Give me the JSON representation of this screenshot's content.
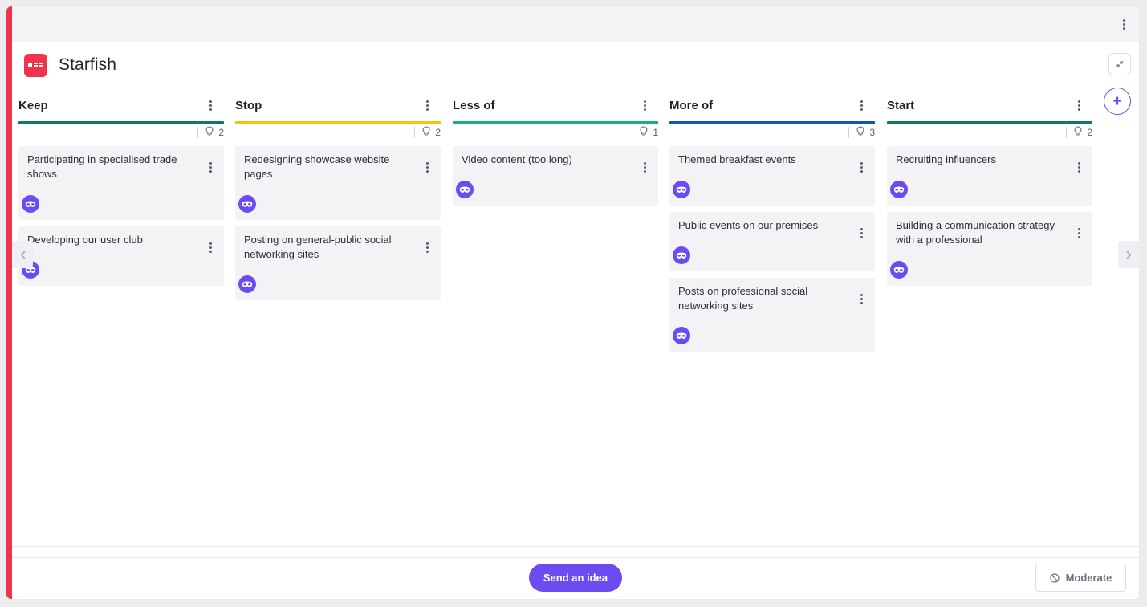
{
  "board": {
    "title": "Starfish",
    "colors": {
      "accent": "#f0344f",
      "primary": "#6b4cf0"
    }
  },
  "toolbar": {
    "menu_icon": "kebab-vertical-icon",
    "collapse_icon": "collapse-arrows-icon",
    "add_column_label": "+"
  },
  "columns": [
    {
      "title": "Keep",
      "color": "#0f7a64",
      "count": "2",
      "cards": [
        {
          "text": "Participating in specialised trade shows"
        },
        {
          "text": "Developing our user club"
        }
      ]
    },
    {
      "title": "Stop",
      "color": "#f4c316",
      "count": "2",
      "cards": [
        {
          "text": "Redesigning showcase website pages"
        },
        {
          "text": "Posting on general-public social networking sites"
        }
      ]
    },
    {
      "title": "Less of",
      "color": "#17b27c",
      "count": "1",
      "cards": [
        {
          "text": "Video content (too long)"
        }
      ]
    },
    {
      "title": "More of",
      "color": "#0d5aa8",
      "count": "3",
      "cards": [
        {
          "text": "Themed breakfast events"
        },
        {
          "text": "Public events on our premises"
        },
        {
          "text": "Posts on professional social networking sites"
        }
      ]
    },
    {
      "title": "Start",
      "color": "#0f7a64",
      "count": "2",
      "cards": [
        {
          "text": "Recruiting influencers"
        },
        {
          "text": "Building a communication strategy with a professional"
        }
      ]
    }
  ],
  "footer": {
    "send_label": "Send an idea",
    "moderate_label": "Moderate"
  }
}
